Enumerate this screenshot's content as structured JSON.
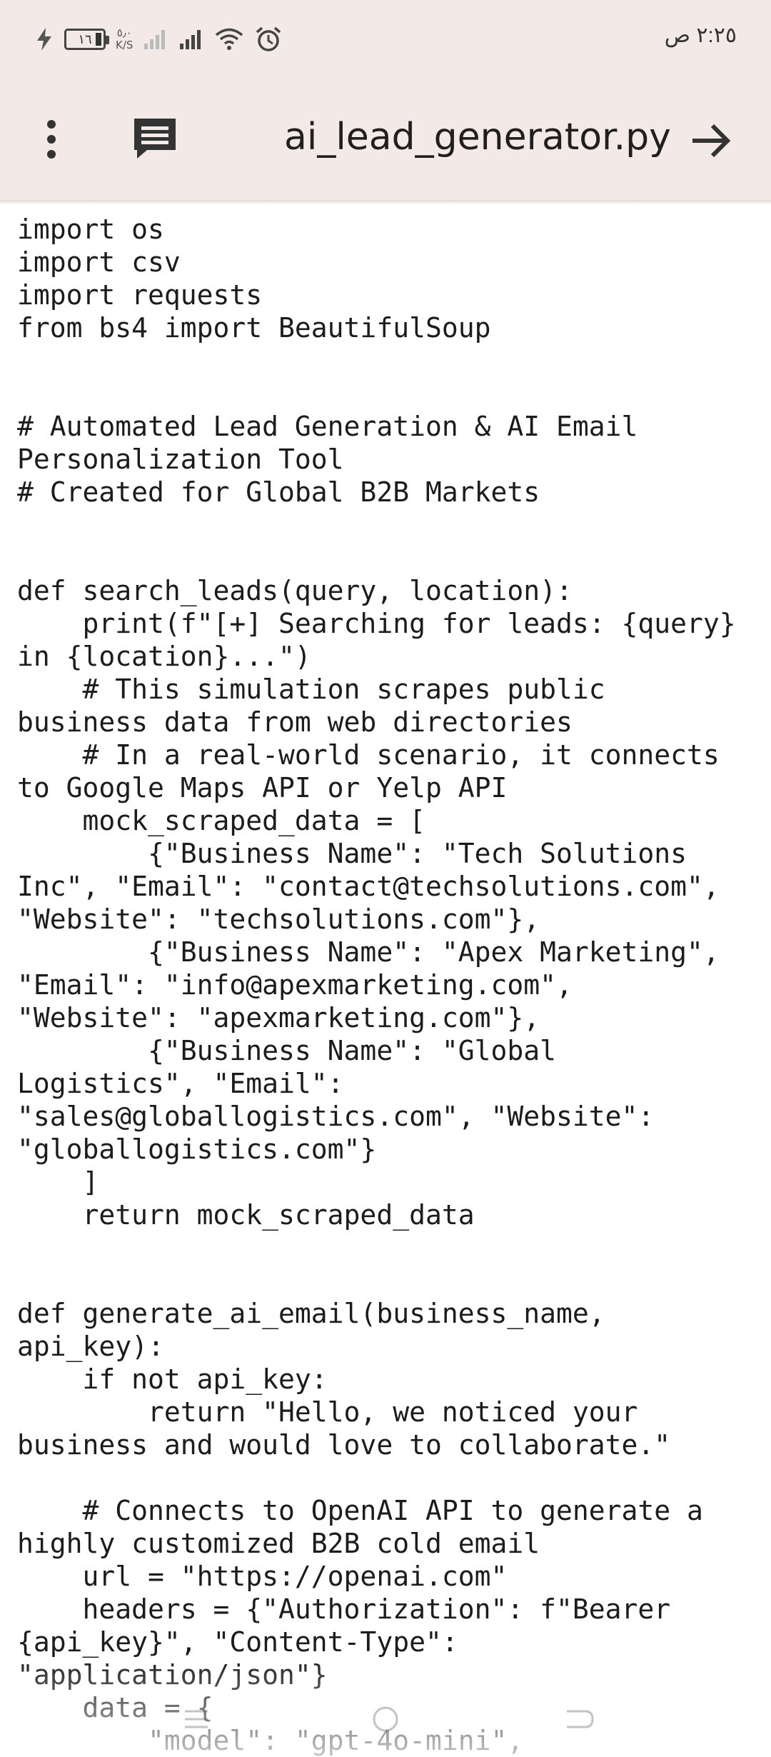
{
  "status_bar": {
    "time": "٢:٢٥ ص",
    "battery_level": "١٦",
    "net_speed_value": "٥٫٠",
    "net_speed_unit": "K/S",
    "icons": [
      "charging-bolt-icon",
      "battery-icon",
      "signal-weak-icon",
      "signal-strong-icon",
      "wifi-icon",
      "alarm-icon"
    ]
  },
  "app_bar": {
    "title": "ai_lead_generator.py",
    "icons": [
      "more-vert-icon",
      "comment-icon",
      "arrow-forward-icon"
    ]
  },
  "code_lines": [
    "import os",
    "import csv",
    "import requests",
    "from bs4 import BeautifulSoup",
    "",
    "",
    "# Automated Lead Generation & AI Email",
    "Personalization Tool",
    "# Created for Global B2B Markets",
    "",
    "",
    "def search_leads(query, location):",
    "    print(f\"[+] Searching for leads: {query}",
    "in {location}...\")",
    "    # This simulation scrapes public",
    "business data from web directories",
    "    # In a real-world scenario, it connects",
    "to Google Maps API or Yelp API",
    "    mock_scraped_data = [",
    "        {\"Business Name\": \"Tech Solutions",
    "Inc\", \"Email\": \"contact@techsolutions.com\",",
    "\"Website\": \"techsolutions.com\"},",
    "        {\"Business Name\": \"Apex Marketing\",",
    "\"Email\": \"info@apexmarketing.com\",",
    "\"Website\": \"apexmarketing.com\"},",
    "        {\"Business Name\": \"Global",
    "Logistics\", \"Email\":",
    "\"sales@globallogistics.com\", \"Website\":",
    "\"globallogistics.com\"}",
    "    ]",
    "    return mock_scraped_data",
    "",
    "",
    "def generate_ai_email(business_name,",
    "api_key):",
    "    if not api_key:",
    "        return \"Hello, we noticed your",
    "business and would love to collaborate.\"",
    "",
    "    # Connects to OpenAI API to generate a",
    "highly customized B2B cold email",
    "    url = \"https://openai.com\"",
    "    headers = {\"Authorization\": f\"Bearer",
    "{api_key}\", \"Content-Type\":",
    "\"application/json\"}",
    "    data = {",
    "        \"model\": \"gpt-4o-mini\","
  ],
  "nav_bar": {
    "icons": [
      "recents-icon",
      "home-icon",
      "back-icon"
    ]
  }
}
